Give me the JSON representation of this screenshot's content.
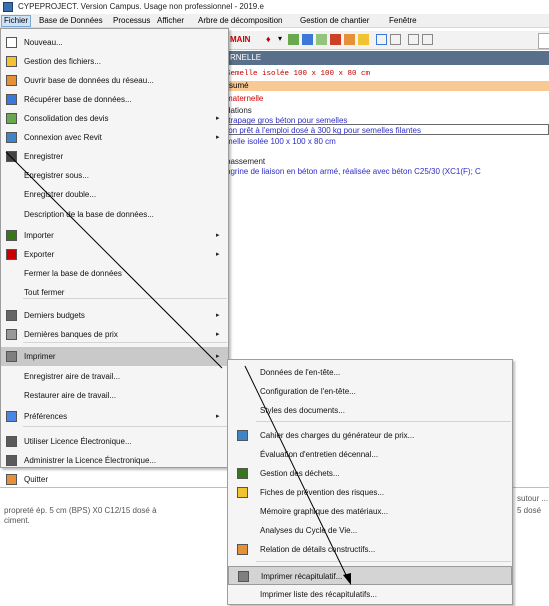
{
  "window": {
    "title": "CYPEPROJECT. Version Campus. Usage non professionnel - 2019.e"
  },
  "menubar": {
    "items": [
      "Fichier",
      "Base de Données",
      "Processus",
      "Afficher",
      "Arbre de décomposition",
      "Gestion de chantier",
      "Fenêtre"
    ]
  },
  "background": {
    "toolbar_field": "MAIN",
    "panel_label": "RNELLE",
    "code_line": "Semelle isolée 100 x 100 x 80 cm",
    "resume_label": "sumé",
    "lines": [
      "maternelle",
      "dations",
      "ttrapage gros béton pour semelles",
      "ton prêt à l'emploi dosé à 300 kg pour semelles filantes",
      "melle isolée 100 x 100 x 80 cm",
      "bassement",
      "ngrine de liaison en béton armé, réalisée avec béton C25/30 (XC1(F); C"
    ],
    "lower_text": [
      "propreté ép. 5 cm (BPS) X0 C12/15 dosé à",
      "ciment.",
      "sutour ...",
      "5 dosé"
    ]
  },
  "file_menu": {
    "items": [
      {
        "label": "Nouveau...",
        "icon": "new-file-icon",
        "submenu": false
      },
      {
        "label": "Gestion des fichiers...",
        "icon": "folder-manage-icon",
        "submenu": false
      },
      {
        "label": "Ouvrir base de données du réseau...",
        "icon": "network-open-icon",
        "submenu": false
      },
      {
        "label": "Récupérer base de données...",
        "icon": "recover-icon",
        "submenu": false
      },
      {
        "label": "Consolidation des devis",
        "icon": "consolidation-icon",
        "submenu": true
      },
      {
        "label": "Connexion avec Revit",
        "icon": "revit-icon",
        "submenu": true
      },
      {
        "label": "Enregistrer",
        "icon": "save-icon",
        "submenu": false
      },
      {
        "label": "Enregistrer sous...",
        "icon": "",
        "submenu": false
      },
      {
        "label": "Enregistrer double...",
        "icon": "",
        "submenu": false
      },
      {
        "label": "Description de la base de données...",
        "icon": "",
        "submenu": false
      },
      {
        "label": "Importer",
        "icon": "import-icon",
        "submenu": true
      },
      {
        "label": "Exporter",
        "icon": "export-icon",
        "submenu": true
      },
      {
        "label": "Fermer la base de données",
        "icon": "",
        "submenu": false
      },
      {
        "label": "Tout fermer",
        "icon": "",
        "submenu": false
      },
      {
        "label": "Derniers budgets",
        "icon": "recent-budgets-icon",
        "submenu": true
      },
      {
        "label": "Dernières banques de prix",
        "icon": "recent-prices-icon",
        "submenu": true
      },
      {
        "label": "Imprimer",
        "icon": "printer-icon",
        "submenu": true
      },
      {
        "label": "Enregistrer aire de travail...",
        "icon": "",
        "submenu": false
      },
      {
        "label": "Restaurer aire de travail...",
        "icon": "",
        "submenu": false
      },
      {
        "label": "Préférences",
        "icon": "preferences-icon",
        "submenu": true
      },
      {
        "label": "Utiliser Licence Électronique...",
        "icon": "license-icon",
        "submenu": false
      },
      {
        "label": "Administrer la Licence Électronique...",
        "icon": "license-admin-icon",
        "submenu": false
      },
      {
        "label": "Quitter",
        "icon": "exit-icon",
        "submenu": false
      }
    ]
  },
  "print_submenu": {
    "items": [
      {
        "label": "Données de l'en-tête...",
        "icon": ""
      },
      {
        "label": "Configuration de l'en-tête...",
        "icon": ""
      },
      {
        "label": "Styles des documents...",
        "icon": ""
      },
      {
        "label": "Cahier des charges du générateur de prix...",
        "icon": "spec-book-icon"
      },
      {
        "label": "Évaluation d'entretien décennal...",
        "icon": ""
      },
      {
        "label": "Gestion des déchets...",
        "icon": "recycle-icon"
      },
      {
        "label": "Fiches de prévention des risques...",
        "icon": "risk-icon"
      },
      {
        "label": "Mémoire graphique des matériaux...",
        "icon": ""
      },
      {
        "label": "Analyses du Cycle de Vie...",
        "icon": ""
      },
      {
        "label": "Relation de détails constructifs...",
        "icon": "details-icon"
      },
      {
        "label": "Imprimer récapitulatif...",
        "icon": "print-summary-icon"
      },
      {
        "label": "Imprimer liste des récapitulatifs...",
        "icon": ""
      }
    ]
  },
  "colors": {
    "menu_bg": "#f5f5f5",
    "highlight": "#c9c9c9",
    "panel_header": "#58708c",
    "resume_bar": "#f9c994",
    "code_red": "#c00000",
    "link_blue": "#2d2dc8"
  }
}
